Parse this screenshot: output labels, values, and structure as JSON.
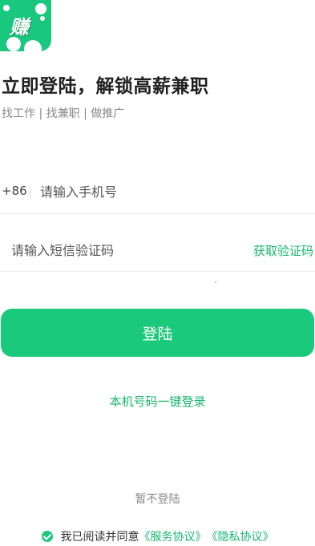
{
  "logo": {
    "glyph": "赚",
    "color": "#19c77e"
  },
  "headline": "立即登陆，解锁高薪兼职",
  "subtitle": "找工作 | 找兼职 | 做推广",
  "phone": {
    "country_code": "+86",
    "placeholder": "请输入手机号"
  },
  "sms": {
    "placeholder": "请输入短信验证码",
    "get_code_label": "获取验证码"
  },
  "login_button": "登陆",
  "one_key_login": "本机号码一键登录",
  "skip_login": "暂不登陆",
  "agreement": {
    "text": "我已阅读并同意",
    "service_link": "《服务协议》",
    "privacy_link": "《隐私协议》",
    "checked": true
  },
  "colors": {
    "accent": "#1ac97b",
    "link": "#17b66f"
  }
}
